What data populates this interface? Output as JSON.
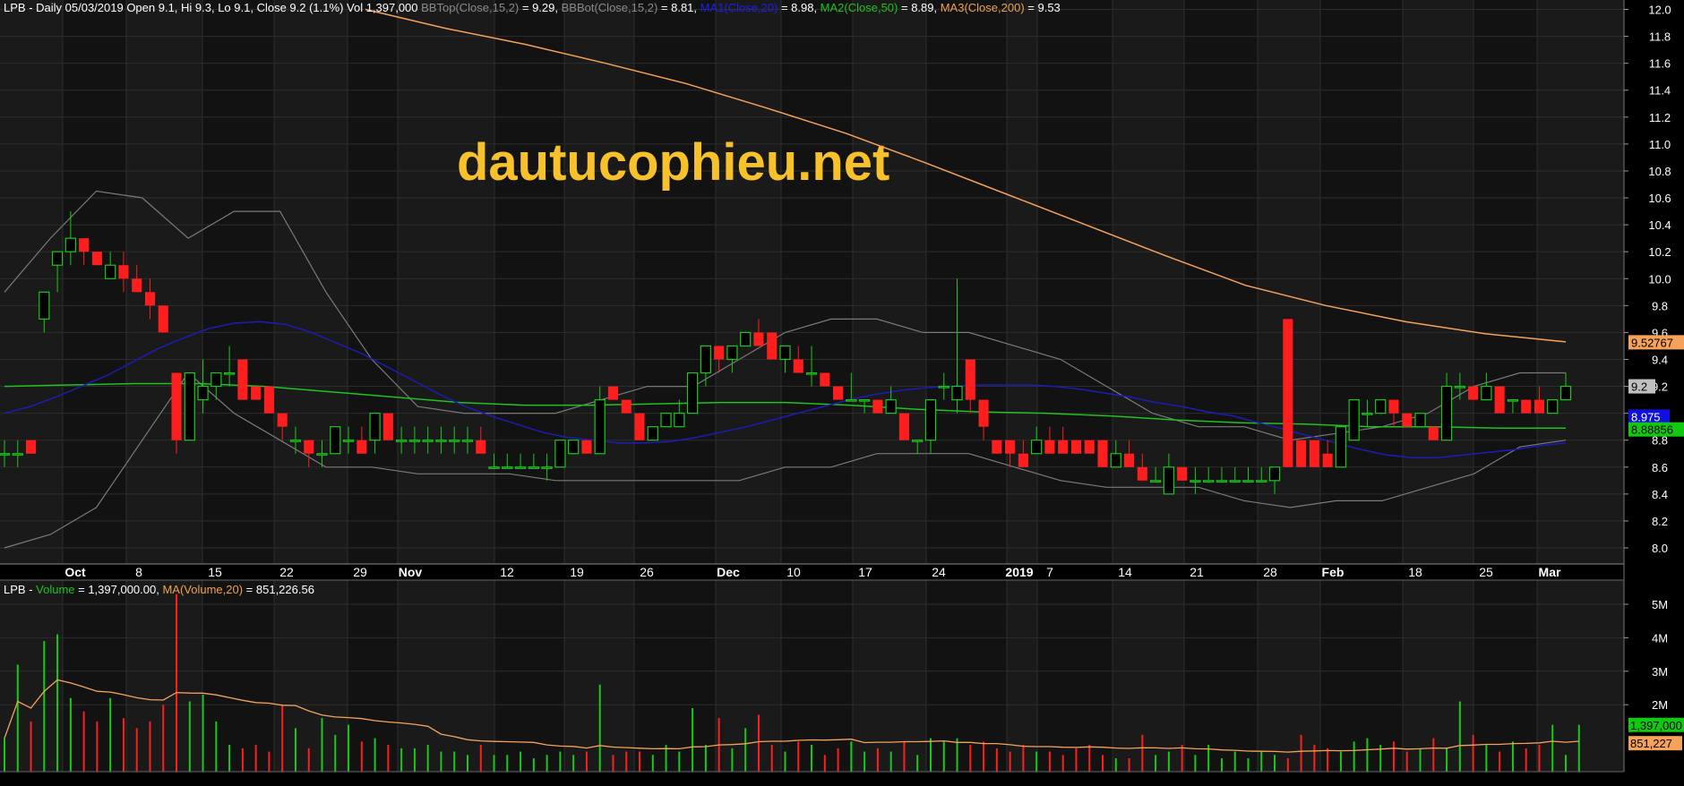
{
  "colors": {
    "background": "#000000",
    "plot_background": "#1a1a1a",
    "band_dark": "#121212",
    "grid": "#2d2d2d",
    "bullish": "#19c919",
    "bearish": "#ff1e1e",
    "ma1": "#1c1cb8",
    "ma2": "#1fc21f",
    "ma3": "#f5a25a",
    "bbands": "#7a7a7a",
    "watermark": "#f7c12b"
  },
  "header": {
    "ticker": "LPB",
    "line1": " - Daily 05/03/2019 Open 9.1, Hi 9.3, Lo 9.1, Close 9.2 (1.1%) Vol 1,397,000 ",
    "bbtop_label": "BBTop(Close,15,2)",
    "bbtop_value": " = 9.29, ",
    "bbbot_label": "BBBot(Close,15,2)",
    "bbbot_value": " = 8.81, ",
    "ma1_label": "MA1(Close,20)",
    "ma1_value": " = 8.98, ",
    "ma2_label": "MA2(Close,50)",
    "ma2_value": " = 8.89, ",
    "ma3_label": "MA3(Close,200)",
    "ma3_value": " = 9.53"
  },
  "volume_header": {
    "ticker": "LPB",
    "sep": " - ",
    "volume_label": "Volume",
    "volume_value": " = 1,397,000.00, ",
    "ma_label": "MA(Volume,20)",
    "ma_value": " = 851,226.56"
  },
  "watermark": "dautucophieu.net",
  "price_axis": {
    "ticks": [
      "12.0",
      "11.8",
      "11.6",
      "11.4",
      "11.2",
      "11.0",
      "10.8",
      "10.6",
      "10.4",
      "10.2",
      "10.0",
      "9.8",
      "9.6",
      "9.4",
      "9.2",
      "9.0",
      "8.8",
      "8.6",
      "8.4",
      "8.2",
      "8.0"
    ],
    "markers": [
      {
        "text": "9.52767",
        "value": 9.527,
        "bg": "#f5a25a",
        "fg": "#000000"
      },
      {
        "text": "9.2",
        "value": 9.2,
        "bg": "#c0c0c0",
        "fg": "#000000"
      },
      {
        "text": "8.975",
        "value": 8.975,
        "bg": "#1010e0",
        "fg": "#ffffff"
      },
      {
        "text": "8.88856",
        "value": 8.88,
        "bg": "#11c911",
        "fg": "#000000"
      }
    ]
  },
  "volume_axis": {
    "ticks": [
      "5M",
      "4M",
      "3M",
      "2M"
    ],
    "markers": [
      {
        "text": "1,397,000",
        "value": 1.397,
        "bg": "#11c911",
        "fg": "#000000"
      },
      {
        "text": "851,227",
        "value": 0.851,
        "bg": "#f5a25a",
        "fg": "#000000"
      }
    ]
  },
  "x_axis_labels": [
    "Oct",
    "8",
    "15",
    "22",
    "29",
    "Nov",
    "12",
    "19",
    "26",
    "Dec",
    "10",
    "17",
    "24",
    "2019",
    "7",
    "14",
    "21",
    "28",
    "Feb",
    "18",
    "25",
    "Mar"
  ],
  "chart_data": {
    "type": "candlestick",
    "ticker": "LPB",
    "period": "Daily",
    "price_ylim": [
      7.9,
      12.05
    ],
    "volume_ylim": [
      0,
      5.8
    ],
    "volume_unit": "M",
    "candles": [
      {
        "o": 8.7,
        "h": 8.8,
        "l": 8.6,
        "c": 8.7
      },
      {
        "o": 8.7,
        "h": 8.8,
        "l": 8.6,
        "c": 8.7
      },
      {
        "o": 8.8,
        "h": 8.8,
        "l": 8.7,
        "c": 8.7
      },
      {
        "o": 9.7,
        "h": 9.9,
        "l": 9.6,
        "c": 9.9
      },
      {
        "o": 10.1,
        "h": 10.2,
        "l": 9.9,
        "c": 10.2
      },
      {
        "o": 10.2,
        "h": 10.5,
        "l": 10.1,
        "c": 10.3
      },
      {
        "o": 10.3,
        "h": 10.3,
        "l": 10.1,
        "c": 10.2
      },
      {
        "o": 10.2,
        "h": 10.2,
        "l": 10.1,
        "c": 10.1
      },
      {
        "o": 10.0,
        "h": 10.2,
        "l": 10.0,
        "c": 10.1
      },
      {
        "o": 10.1,
        "h": 10.2,
        "l": 9.9,
        "c": 10.0
      },
      {
        "o": 10.0,
        "h": 10.1,
        "l": 9.9,
        "c": 9.9
      },
      {
        "o": 9.9,
        "h": 10.0,
        "l": 9.7,
        "c": 9.8
      },
      {
        "o": 9.8,
        "h": 9.8,
        "l": 9.6,
        "c": 9.6
      },
      {
        "o": 9.3,
        "h": 9.3,
        "l": 8.7,
        "c": 8.8
      },
      {
        "o": 8.8,
        "h": 9.3,
        "l": 8.8,
        "c": 9.3
      },
      {
        "o": 9.1,
        "h": 9.4,
        "l": 9.0,
        "c": 9.2
      },
      {
        "o": 9.2,
        "h": 9.3,
        "l": 9.1,
        "c": 9.3
      },
      {
        "o": 9.3,
        "h": 9.5,
        "l": 9.2,
        "c": 9.3
      },
      {
        "o": 9.4,
        "h": 9.4,
        "l": 9.1,
        "c": 9.1
      },
      {
        "o": 9.2,
        "h": 9.2,
        "l": 9.1,
        "c": 9.1
      },
      {
        "o": 9.2,
        "h": 9.2,
        "l": 9.0,
        "c": 9.0
      },
      {
        "o": 9.0,
        "h": 9.0,
        "l": 8.8,
        "c": 8.9
      },
      {
        "o": 8.8,
        "h": 8.9,
        "l": 8.7,
        "c": 8.8
      },
      {
        "o": 8.8,
        "h": 8.8,
        "l": 8.6,
        "c": 8.7
      },
      {
        "o": 8.7,
        "h": 8.8,
        "l": 8.6,
        "c": 8.7
      },
      {
        "o": 8.7,
        "h": 8.9,
        "l": 8.7,
        "c": 8.9
      },
      {
        "o": 8.8,
        "h": 8.9,
        "l": 8.7,
        "c": 8.8
      },
      {
        "o": 8.8,
        "h": 8.9,
        "l": 8.7,
        "c": 8.7
      },
      {
        "o": 8.8,
        "h": 9.0,
        "l": 8.7,
        "c": 9.0
      },
      {
        "o": 9.0,
        "h": 9.0,
        "l": 8.8,
        "c": 8.8
      },
      {
        "o": 8.8,
        "h": 8.9,
        "l": 8.7,
        "c": 8.8
      },
      {
        "o": 8.8,
        "h": 8.9,
        "l": 8.7,
        "c": 8.8
      },
      {
        "o": 8.8,
        "h": 8.9,
        "l": 8.7,
        "c": 8.8
      },
      {
        "o": 8.8,
        "h": 8.9,
        "l": 8.7,
        "c": 8.8
      },
      {
        "o": 8.8,
        "h": 8.9,
        "l": 8.7,
        "c": 8.8
      },
      {
        "o": 8.8,
        "h": 8.9,
        "l": 8.7,
        "c": 8.8
      },
      {
        "o": 8.8,
        "h": 8.9,
        "l": 8.7,
        "c": 8.7
      },
      {
        "o": 8.6,
        "h": 8.7,
        "l": 8.6,
        "c": 8.6
      },
      {
        "o": 8.6,
        "h": 8.7,
        "l": 8.6,
        "c": 8.6
      },
      {
        "o": 8.6,
        "h": 8.7,
        "l": 8.6,
        "c": 8.6
      },
      {
        "o": 8.6,
        "h": 8.7,
        "l": 8.6,
        "c": 8.6
      },
      {
        "o": 8.6,
        "h": 8.7,
        "l": 8.5,
        "c": 8.6
      },
      {
        "o": 8.6,
        "h": 8.8,
        "l": 8.6,
        "c": 8.8
      },
      {
        "o": 8.7,
        "h": 8.8,
        "l": 8.7,
        "c": 8.8
      },
      {
        "o": 8.8,
        "h": 8.8,
        "l": 8.7,
        "c": 8.7
      },
      {
        "o": 8.7,
        "h": 9.2,
        "l": 8.7,
        "c": 9.1
      },
      {
        "o": 9.2,
        "h": 9.2,
        "l": 9.1,
        "c": 9.1
      },
      {
        "o": 9.1,
        "h": 9.1,
        "l": 9.0,
        "c": 9.0
      },
      {
        "o": 9.0,
        "h": 9.0,
        "l": 8.8,
        "c": 8.8
      },
      {
        "o": 8.8,
        "h": 8.9,
        "l": 8.8,
        "c": 8.9
      },
      {
        "o": 8.9,
        "h": 9.0,
        "l": 8.9,
        "c": 9.0
      },
      {
        "o": 8.9,
        "h": 9.1,
        "l": 8.9,
        "c": 9.0
      },
      {
        "o": 9.0,
        "h": 9.3,
        "l": 9.0,
        "c": 9.3
      },
      {
        "o": 9.3,
        "h": 9.5,
        "l": 9.2,
        "c": 9.5
      },
      {
        "o": 9.5,
        "h": 9.5,
        "l": 9.3,
        "c": 9.4
      },
      {
        "o": 9.4,
        "h": 9.5,
        "l": 9.3,
        "c": 9.5
      },
      {
        "o": 9.5,
        "h": 9.6,
        "l": 9.5,
        "c": 9.6
      },
      {
        "o": 9.6,
        "h": 9.7,
        "l": 9.5,
        "c": 9.5
      },
      {
        "o": 9.6,
        "h": 9.6,
        "l": 9.4,
        "c": 9.4
      },
      {
        "o": 9.4,
        "h": 9.5,
        "l": 9.3,
        "c": 9.5
      },
      {
        "o": 9.4,
        "h": 9.5,
        "l": 9.3,
        "c": 9.3
      },
      {
        "o": 9.3,
        "h": 9.5,
        "l": 9.2,
        "c": 9.3
      },
      {
        "o": 9.3,
        "h": 9.3,
        "l": 9.2,
        "c": 9.2
      },
      {
        "o": 9.2,
        "h": 9.2,
        "l": 9.1,
        "c": 9.1
      },
      {
        "o": 9.1,
        "h": 9.3,
        "l": 9.1,
        "c": 9.1
      },
      {
        "o": 9.1,
        "h": 9.1,
        "l": 9.0,
        "c": 9.1
      },
      {
        "o": 9.1,
        "h": 9.1,
        "l": 9.0,
        "c": 9.0
      },
      {
        "o": 9.0,
        "h": 9.2,
        "l": 9.0,
        "c": 9.1
      },
      {
        "o": 9.0,
        "h": 9.0,
        "l": 8.8,
        "c": 8.8
      },
      {
        "o": 8.8,
        "h": 8.8,
        "l": 8.7,
        "c": 8.8
      },
      {
        "o": 8.8,
        "h": 9.1,
        "l": 8.7,
        "c": 9.1
      },
      {
        "o": 9.2,
        "h": 9.3,
        "l": 9.1,
        "c": 9.2
      },
      {
        "o": 9.1,
        "h": 10.0,
        "l": 9.0,
        "c": 9.2
      },
      {
        "o": 9.4,
        "h": 9.4,
        "l": 9.0,
        "c": 9.1
      },
      {
        "o": 9.1,
        "h": 9.1,
        "l": 8.8,
        "c": 8.9
      },
      {
        "o": 8.8,
        "h": 8.8,
        "l": 8.7,
        "c": 8.7
      },
      {
        "o": 8.8,
        "h": 8.8,
        "l": 8.6,
        "c": 8.7
      },
      {
        "o": 8.7,
        "h": 8.8,
        "l": 8.6,
        "c": 8.6
      },
      {
        "o": 8.7,
        "h": 8.9,
        "l": 8.7,
        "c": 8.8
      },
      {
        "o": 8.8,
        "h": 8.9,
        "l": 8.7,
        "c": 8.7
      },
      {
        "o": 8.8,
        "h": 8.9,
        "l": 8.7,
        "c": 8.7
      },
      {
        "o": 8.8,
        "h": 8.8,
        "l": 8.7,
        "c": 8.7
      },
      {
        "o": 8.8,
        "h": 8.8,
        "l": 8.7,
        "c": 8.7
      },
      {
        "o": 8.8,
        "h": 8.8,
        "l": 8.6,
        "c": 8.6
      },
      {
        "o": 8.6,
        "h": 8.8,
        "l": 8.6,
        "c": 8.7
      },
      {
        "o": 8.7,
        "h": 8.8,
        "l": 8.6,
        "c": 8.6
      },
      {
        "o": 8.6,
        "h": 8.7,
        "l": 8.5,
        "c": 8.5
      },
      {
        "o": 8.5,
        "h": 8.6,
        "l": 8.5,
        "c": 8.5
      },
      {
        "o": 8.4,
        "h": 8.7,
        "l": 8.4,
        "c": 8.6
      },
      {
        "o": 8.6,
        "h": 8.6,
        "l": 8.5,
        "c": 8.5
      },
      {
        "o": 8.5,
        "h": 8.6,
        "l": 8.4,
        "c": 8.5
      },
      {
        "o": 8.5,
        "h": 8.6,
        "l": 8.5,
        "c": 8.5
      },
      {
        "o": 8.5,
        "h": 8.6,
        "l": 8.5,
        "c": 8.5
      },
      {
        "o": 8.5,
        "h": 8.6,
        "l": 8.5,
        "c": 8.5
      },
      {
        "o": 8.5,
        "h": 8.6,
        "l": 8.5,
        "c": 8.5
      },
      {
        "o": 8.5,
        "h": 8.6,
        "l": 8.5,
        "c": 8.5
      },
      {
        "o": 8.5,
        "h": 8.6,
        "l": 8.4,
        "c": 8.6
      },
      {
        "o": 9.7,
        "h": 9.7,
        "l": 8.6,
        "c": 8.6
      },
      {
        "o": 8.8,
        "h": 8.8,
        "l": 8.6,
        "c": 8.6
      },
      {
        "o": 8.8,
        "h": 8.8,
        "l": 8.6,
        "c": 8.6
      },
      {
        "o": 8.7,
        "h": 8.8,
        "l": 8.6,
        "c": 8.6
      },
      {
        "o": 8.6,
        "h": 8.9,
        "l": 8.6,
        "c": 8.9
      },
      {
        "o": 8.8,
        "h": 9.1,
        "l": 8.8,
        "c": 9.1
      },
      {
        "o": 9.0,
        "h": 9.1,
        "l": 8.9,
        "c": 9.0
      },
      {
        "o": 9.0,
        "h": 9.1,
        "l": 9.0,
        "c": 9.1
      },
      {
        "o": 9.1,
        "h": 9.1,
        "l": 8.9,
        "c": 9.0
      },
      {
        "o": 9.0,
        "h": 9.0,
        "l": 8.9,
        "c": 8.9
      },
      {
        "o": 8.9,
        "h": 9.0,
        "l": 8.9,
        "c": 9.0
      },
      {
        "o": 8.9,
        "h": 8.9,
        "l": 8.8,
        "c": 8.8
      },
      {
        "o": 8.8,
        "h": 9.3,
        "l": 8.8,
        "c": 9.2
      },
      {
        "o": 9.2,
        "h": 9.3,
        "l": 9.1,
        "c": 9.2
      },
      {
        "o": 9.2,
        "h": 9.2,
        "l": 9.1,
        "c": 9.1
      },
      {
        "o": 9.1,
        "h": 9.3,
        "l": 9.1,
        "c": 9.2
      },
      {
        "o": 9.2,
        "h": 9.2,
        "l": 9.0,
        "c": 9.0
      },
      {
        "o": 9.1,
        "h": 9.1,
        "l": 9.0,
        "c": 9.1
      },
      {
        "o": 9.1,
        "h": 9.1,
        "l": 9.0,
        "c": 9.0
      },
      {
        "o": 9.1,
        "h": 9.2,
        "l": 9.0,
        "c": 9.0
      },
      {
        "o": 9.0,
        "h": 9.1,
        "l": 9.0,
        "c": 9.1
      },
      {
        "o": 9.1,
        "h": 9.3,
        "l": 9.1,
        "c": 9.2
      }
    ],
    "volume": [
      1.0,
      3.2,
      1.5,
      3.9,
      4.1,
      2.2,
      1.8,
      1.5,
      2.2,
      1.6,
      1.3,
      1.5,
      2.0,
      5.3,
      2.1,
      2.3,
      1.5,
      0.8,
      0.7,
      0.8,
      0.6,
      2.0,
      1.3,
      0.7,
      1.6,
      1.1,
      1.4,
      0.9,
      1.0,
      0.8,
      0.7,
      0.7,
      0.8,
      0.6,
      0.6,
      0.5,
      0.8,
      0.5,
      0.5,
      0.6,
      0.4,
      0.5,
      0.6,
      0.5,
      0.6,
      2.6,
      0.5,
      0.6,
      0.6,
      0.5,
      0.8,
      0.6,
      1.9,
      0.8,
      1.6,
      0.7,
      1.3,
      1.7,
      0.8,
      0.6,
      0.9,
      0.8,
      0.5,
      0.7,
      0.9,
      0.6,
      0.7,
      0.6,
      0.9,
      0.5,
      1.0,
      0.9,
      1.0,
      0.8,
      0.9,
      0.7,
      0.6,
      0.8,
      0.6,
      0.6,
      0.5,
      0.7,
      0.8,
      0.5,
      0.4,
      0.4,
      1.1,
      0.5,
      0.6,
      0.8,
      0.5,
      0.8,
      0.4,
      0.6,
      0.4,
      0.6,
      0.5,
      0.4,
      1.1,
      0.8,
      0.7,
      0.6,
      0.9,
      1.0,
      0.8,
      0.9,
      0.6,
      0.7,
      1.0,
      0.7,
      2.1,
      1.1,
      0.8,
      0.6,
      0.9,
      0.7,
      0.8,
      1.4,
      0.5,
      1.4
    ],
    "ma1": [
      9.0,
      9.05,
      9.12,
      9.2,
      9.28,
      9.38,
      9.48,
      9.56,
      9.63,
      9.67,
      9.68,
      9.66,
      9.6,
      9.52,
      9.44,
      9.34,
      9.24,
      9.14,
      9.05,
      8.98,
      8.92,
      8.86,
      8.82,
      8.8,
      8.78,
      8.78,
      8.79,
      8.82,
      8.86,
      8.9,
      8.95,
      9.0,
      9.05,
      9.1,
      9.14,
      9.17,
      9.19,
      9.2,
      9.21,
      9.21,
      9.21,
      9.2,
      9.18,
      9.15,
      9.12,
      9.08,
      9.05,
      9.01,
      8.98,
      8.93,
      8.88,
      8.83,
      8.78,
      8.73,
      8.69,
      8.67,
      8.67,
      8.69,
      8.71,
      8.73,
      8.76,
      8.78
    ],
    "ma2": [
      9.2,
      9.21,
      9.22,
      9.22,
      9.2,
      9.16,
      9.12,
      9.08,
      9.06,
      9.06,
      9.07,
      9.08,
      9.08,
      9.06,
      9.03,
      9.01,
      9.0,
      8.98,
      8.95,
      8.93,
      8.92,
      8.9,
      8.9,
      8.89,
      8.89
    ],
    "ma3": [
      12.0,
      11.86,
      11.74,
      11.6,
      11.45,
      11.27,
      11.08,
      10.86,
      10.63,
      10.4,
      10.17,
      9.95,
      9.8,
      9.68,
      9.59,
      9.53
    ],
    "bb_top": [
      9.9,
      10.3,
      10.65,
      10.6,
      10.3,
      10.5,
      10.5,
      9.9,
      9.4,
      9.05,
      9.0,
      9.0,
      9.0,
      9.1,
      9.2,
      9.2,
      9.4,
      9.6,
      9.7,
      9.7,
      9.6,
      9.6,
      9.5,
      9.4,
      9.2,
      9.0,
      8.9,
      8.9,
      8.8,
      8.85,
      8.9,
      9.0,
      9.2,
      9.3,
      9.3
    ],
    "bb_bot": [
      8.0,
      8.1,
      8.3,
      8.8,
      9.3,
      9.0,
      8.8,
      8.6,
      8.6,
      8.55,
      8.55,
      8.55,
      8.5,
      8.5,
      8.5,
      8.5,
      8.5,
      8.6,
      8.6,
      8.7,
      8.7,
      8.7,
      8.6,
      8.5,
      8.45,
      8.45,
      8.45,
      8.35,
      8.3,
      8.35,
      8.35,
      8.45,
      8.55,
      8.75,
      8.8
    ]
  }
}
